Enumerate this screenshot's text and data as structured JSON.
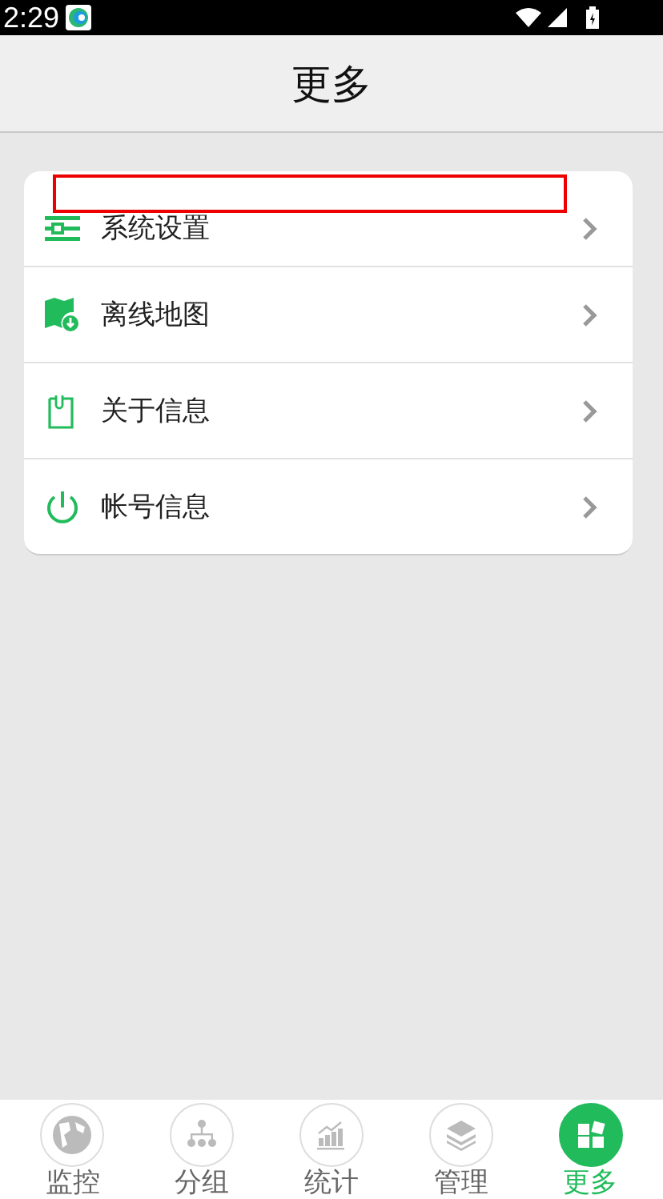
{
  "status_bar": {
    "time": "2:29"
  },
  "header": {
    "title": "更多"
  },
  "menu_items": [
    {
      "label": "系统设置",
      "highlighted": true
    },
    {
      "label": "离线地图",
      "highlighted": false
    },
    {
      "label": "关于信息",
      "highlighted": false
    },
    {
      "label": "帐号信息",
      "highlighted": false
    }
  ],
  "tabs": [
    {
      "label": "监控",
      "selected": false
    },
    {
      "label": "分组",
      "selected": false
    },
    {
      "label": "统计",
      "selected": false
    },
    {
      "label": "管理",
      "selected": false
    },
    {
      "label": "更多",
      "selected": true
    }
  ]
}
